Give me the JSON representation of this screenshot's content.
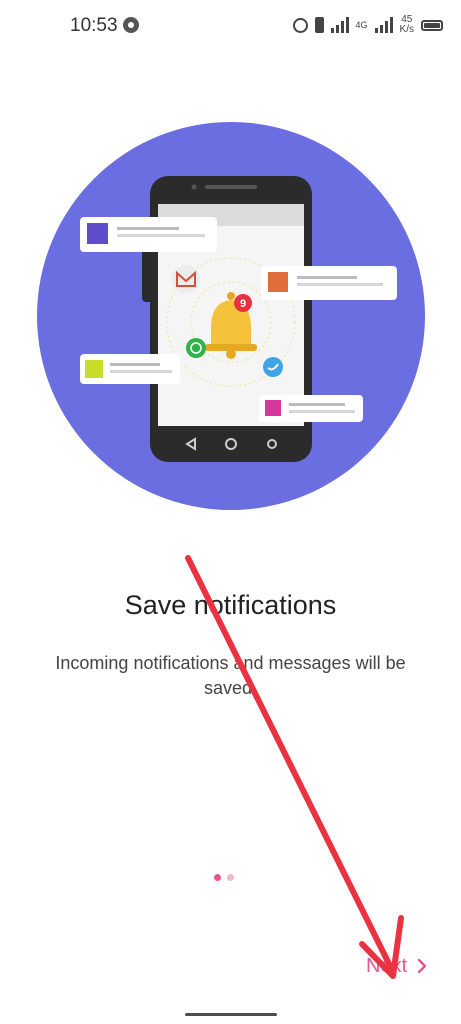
{
  "status_bar": {
    "time": "10:53",
    "network_type": "4G",
    "net_speed_value": "45",
    "net_speed_unit": "K/s"
  },
  "illustration": {
    "badge_count": "9",
    "colors": {
      "circle": "#6a6ee0",
      "bell": "#f5c33b",
      "badge": "#e8313f",
      "card_purple": "#5f4ecb",
      "card_orange": "#e06d3c",
      "card_lime": "#c8dc2c",
      "card_pink": "#d8379a"
    },
    "icons": [
      "gmail-icon",
      "whatsapp-icon",
      "twitter-icon",
      "bell-icon"
    ]
  },
  "onboarding": {
    "title": "Save notifications",
    "description": "Incoming notifications and messages will be saved.",
    "page_count": 2,
    "active_page": 1
  },
  "footer": {
    "next_label": "Next"
  },
  "colors": {
    "accent": "#e8568e",
    "annotation": "#ea3340"
  }
}
